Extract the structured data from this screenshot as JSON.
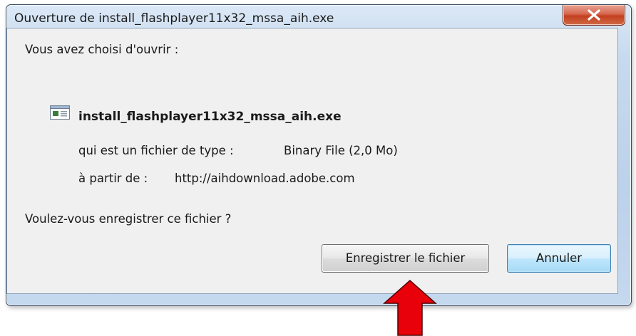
{
  "window": {
    "title": "Ouverture de install_flashplayer11x32_mssa_aih.exe"
  },
  "dialog": {
    "intro": "Vous avez choisi d'ouvrir :",
    "file_name": "install_flashplayer11x32_mssa_aih.exe",
    "type_label": "qui est un fichier de type :",
    "type_value": "Binary File (2,0 Mo)",
    "from_label": "à partir de :",
    "from_value": "http://aihdownload.adobe.com",
    "question": "Voulez-vous enregistrer ce fichier ?"
  },
  "buttons": {
    "save_label": "Enregistrer le fichier",
    "cancel_label": "Annuler"
  },
  "icons": {
    "close": "close-icon",
    "file": "executable-file-icon",
    "annotation": "red-arrow-icon"
  },
  "colors": {
    "close_button": "#c84a2b",
    "annotation_arrow": "#e8000b",
    "focus_button_border": "#3c7fb1"
  }
}
